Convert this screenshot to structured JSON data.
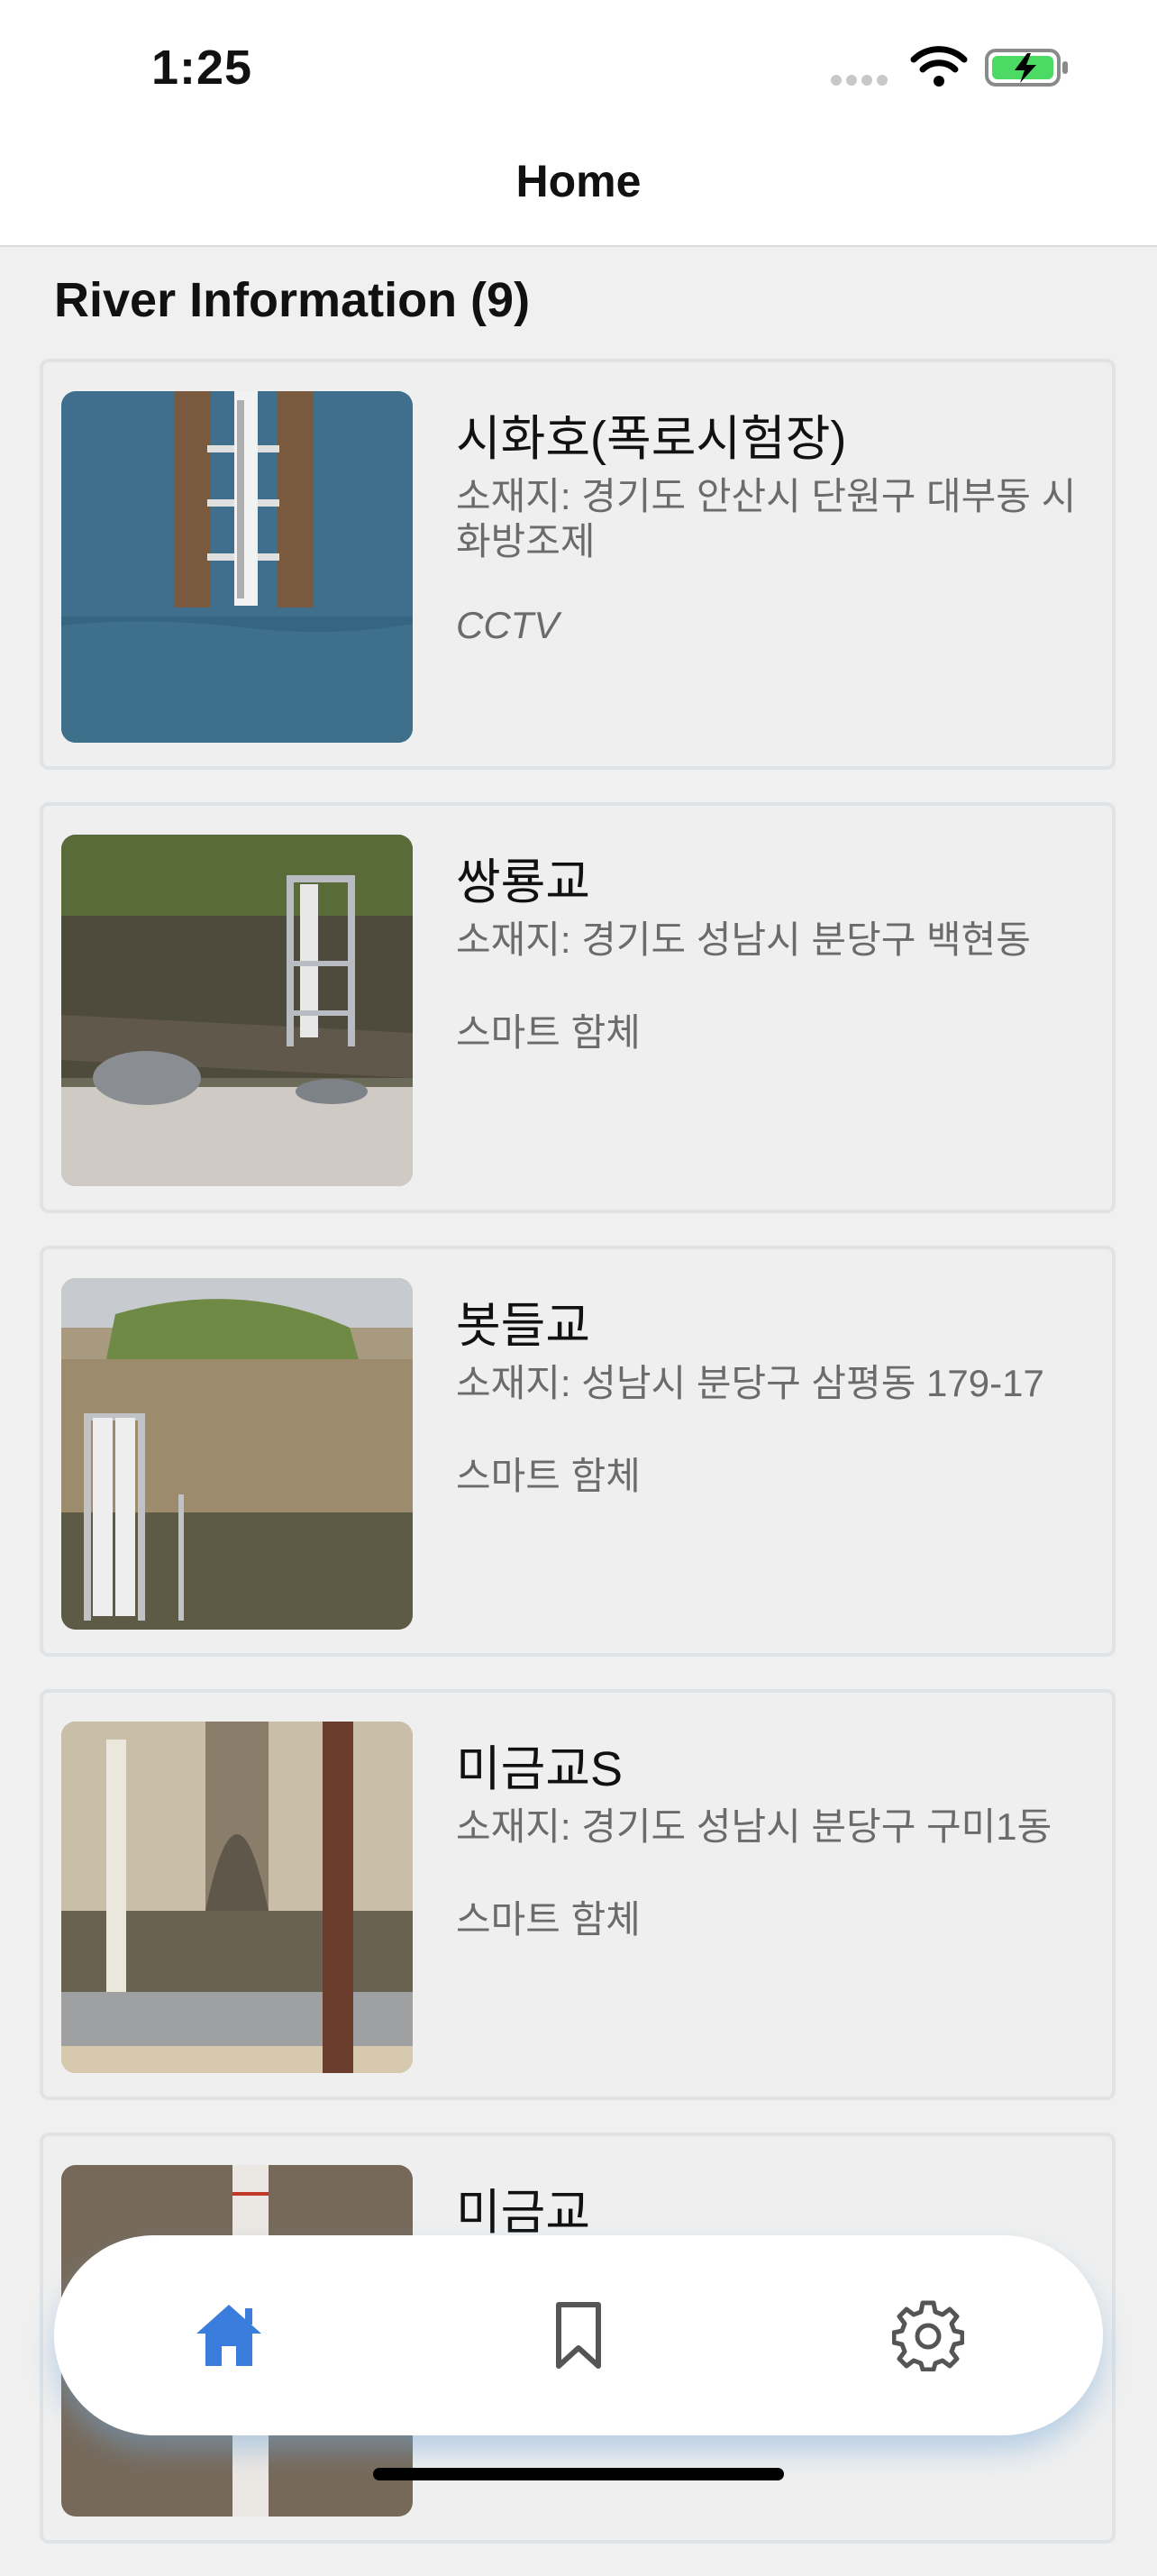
{
  "status_bar": {
    "time": "1:25"
  },
  "header": {
    "title": "Home"
  },
  "section": {
    "title": "River Information (9)"
  },
  "rivers": [
    {
      "name": "시화호(폭로시험장)",
      "address": "소재지: 경기도 안산시 단원구 대부동 시화방조제",
      "type": "CCTV"
    },
    {
      "name": "쌍룡교",
      "address": "소재지: 경기도 성남시 분당구 백현동",
      "type": "스마트 함체"
    },
    {
      "name": "봇들교",
      "address": "소재지: 성남시 분당구 삼평동 179-17",
      "type": "스마트 함체"
    },
    {
      "name": "미금교S",
      "address": "소재지: 경기도 성남시 분당구 구미1동",
      "type": "스마트 함체"
    },
    {
      "name": "미금교",
      "address": "",
      "type": ""
    }
  ],
  "tabbar": {
    "items": [
      {
        "icon": "home-icon",
        "active": true
      },
      {
        "icon": "bookmark-icon",
        "active": false
      },
      {
        "icon": "gear-icon",
        "active": false
      }
    ],
    "active_color": "#3b7ddd",
    "inactive_color": "#555555"
  }
}
